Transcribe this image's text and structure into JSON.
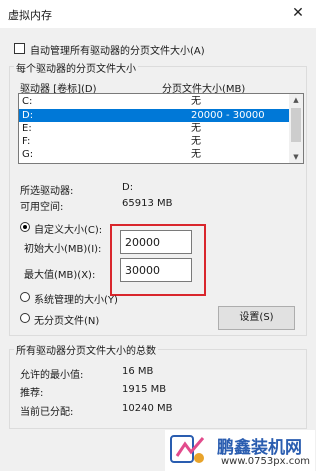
{
  "window": {
    "title": "虚拟内存",
    "close_glyph": "✕"
  },
  "auto_manage": {
    "label": "自动管理所有驱动器的分页文件大小(A)",
    "checked": false
  },
  "per_drive_group": {
    "legend": "每个驱动器的分页文件大小",
    "col_drive": "驱动器 [卷标](D)",
    "col_size": "分页文件大小(MB)",
    "rows": [
      {
        "drive": "C:",
        "size": "无",
        "selected": false
      },
      {
        "drive": "D:",
        "size": "20000 - 30000",
        "selected": true
      },
      {
        "drive": "E:",
        "size": "无",
        "selected": false
      },
      {
        "drive": "F:",
        "size": "无",
        "selected": false
      },
      {
        "drive": "G:",
        "size": "无",
        "selected": false
      }
    ],
    "selected_drive_label": "所选驱动器:",
    "selected_drive_value": "D:",
    "free_space_label": "可用空间:",
    "free_space_value": "65913 MB",
    "custom_size_label": "自定义大小(C):",
    "initial_label": "初始大小(MB)(I):",
    "initial_value": "20000",
    "max_label": "最大值(MB)(X):",
    "max_value": "30000",
    "system_managed_label": "系统管理的大小(Y)",
    "no_paging_label": "无分页文件(N)",
    "set_button": "设置(S)",
    "selected_option": "custom",
    "highlight_color": "#d9262c"
  },
  "totals_group": {
    "legend": "所有驱动器分页文件大小的总数",
    "min_label": "允许的最小值:",
    "min_value": "16 MB",
    "rec_label": "推荐:",
    "rec_value": "1915 MB",
    "alloc_label": "当前已分配:",
    "alloc_value": "10240 MB"
  },
  "watermark": {
    "title": "鹏鑫装机网",
    "url": "www.0753px.com"
  },
  "colors": {
    "selection": "#0078d7",
    "watermark_blue": "#2a5db0"
  }
}
